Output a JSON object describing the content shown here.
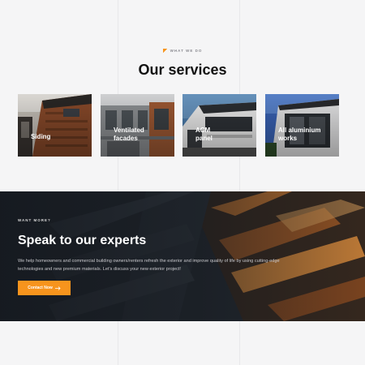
{
  "services": {
    "eyebrow": "WHAT WE DO",
    "title": "Our services",
    "items": [
      {
        "label": "Siding"
      },
      {
        "label_line1": "Ventilated",
        "label_line2": "facades"
      },
      {
        "label_line1": "ACM",
        "label_line2": "panel"
      },
      {
        "label_line1": "All aluminium",
        "label_line2": "works"
      }
    ]
  },
  "cta": {
    "eyebrow": "WANT MORE?",
    "title": "Speak to our experts",
    "description_line1": "We help homeowners and commercial building owners/renters refresh the exterior and improve quality of life by using cutting-edge",
    "description_line2": "technologies and new premium materials. Let's discuss your new exterior project!",
    "button_label": "Contact Now",
    "button_icon": "arrow-right-icon"
  },
  "colors": {
    "accent": "#f7941d",
    "dark_bg": "#1c2129",
    "page_bg": "#f5f5f6"
  }
}
